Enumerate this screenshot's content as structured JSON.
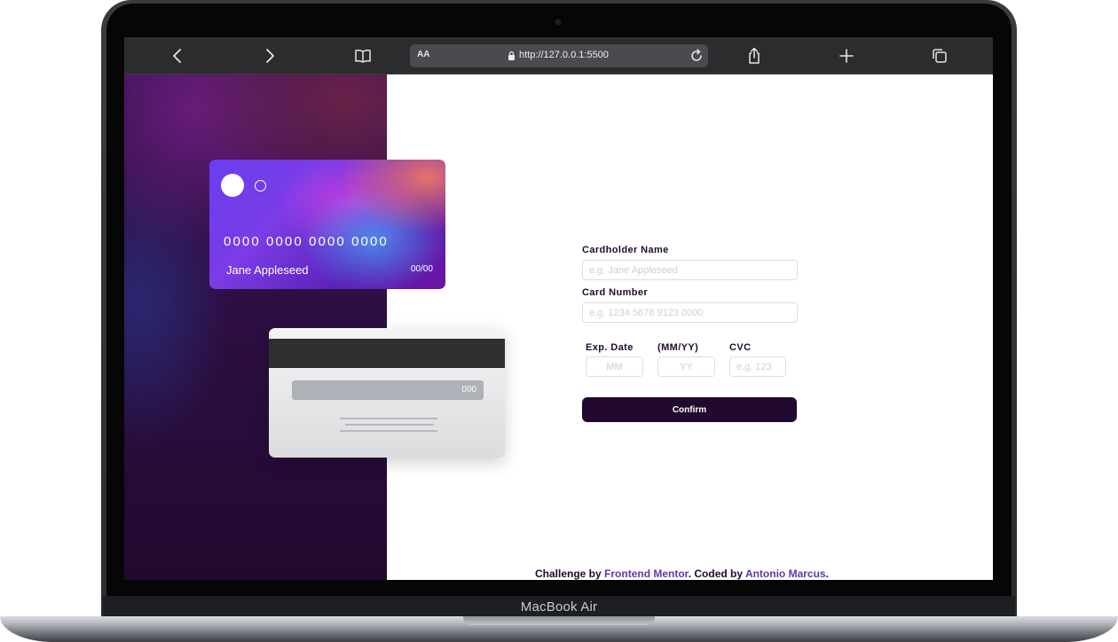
{
  "device": {
    "model": "MacBook Air"
  },
  "browser": {
    "reader_label": "AA",
    "url": "http://127.0.0.1:5500"
  },
  "card_front": {
    "number": "0000 0000 0000 0000",
    "name": "Jane Appleseed",
    "expiry": "00/00"
  },
  "card_back": {
    "cvc": "000"
  },
  "form": {
    "cardholder_label": "Cardholder Name",
    "cardholder_placeholder": "e.g. Jane Appleseed",
    "number_label": "Card Number",
    "number_placeholder": "e.g. 1234 5678 9123 0000",
    "exp_label": "Exp. Date",
    "exp_format_label": "(MM/YY)",
    "cvc_label": "CVC",
    "mm_placeholder": "MM",
    "yy_placeholder": "YY",
    "cvc_placeholder": "e.g. 123",
    "confirm_label": "Confirm"
  },
  "attribution": {
    "prefix": "Challenge by ",
    "link1": "Frontend Mentor",
    "middle": ". Coded by ",
    "link2": "Antonio Marcus",
    "suffix": "."
  }
}
